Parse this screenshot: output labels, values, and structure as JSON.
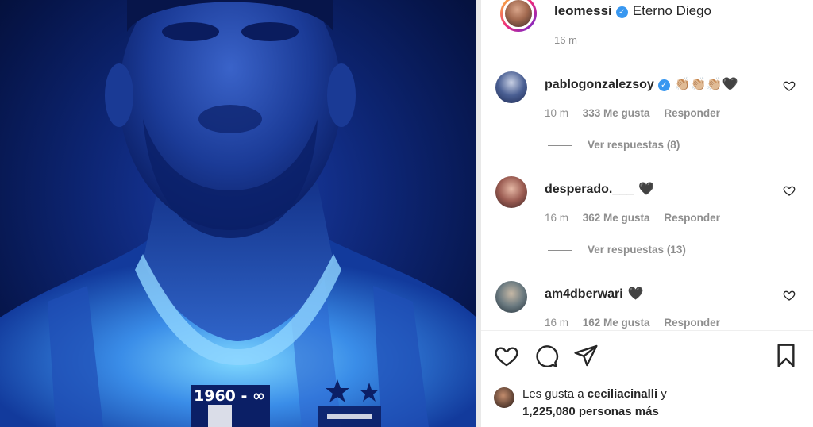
{
  "post": {
    "username": "leomessi",
    "caption": "Eterno Diego",
    "time": "16 m",
    "jersey_text": "1960 - ∞"
  },
  "comments": [
    {
      "user": "pablogonzalezsoy",
      "verified": true,
      "text": "👏🏼👏🏼👏🏼🖤",
      "time": "10 m",
      "likes": "333 Me gusta",
      "reply": "Responder",
      "replies": "Ver respuestas (8)"
    },
    {
      "user": "desperado.___",
      "verified": false,
      "text": "🖤",
      "time": "16 m",
      "likes": "362 Me gusta",
      "reply": "Responder",
      "replies": "Ver respuestas (13)"
    },
    {
      "user": "am4dberwari",
      "verified": false,
      "text": "🖤",
      "time": "16 m",
      "likes": "162 Me gusta",
      "reply": "Responder"
    }
  ],
  "likes": {
    "prefix": "Les gusta a",
    "user": "ceciliacinalli",
    "conj": "y",
    "others": "1,225,080 personas más"
  },
  "icons": [
    "heart-icon",
    "comment-icon",
    "share-icon",
    "bookmark-icon",
    "verified-icon"
  ],
  "colors": {
    "photo_blue": "#0d2573",
    "verified": "#3897f0",
    "meta_gray": "#8e8e8e"
  }
}
